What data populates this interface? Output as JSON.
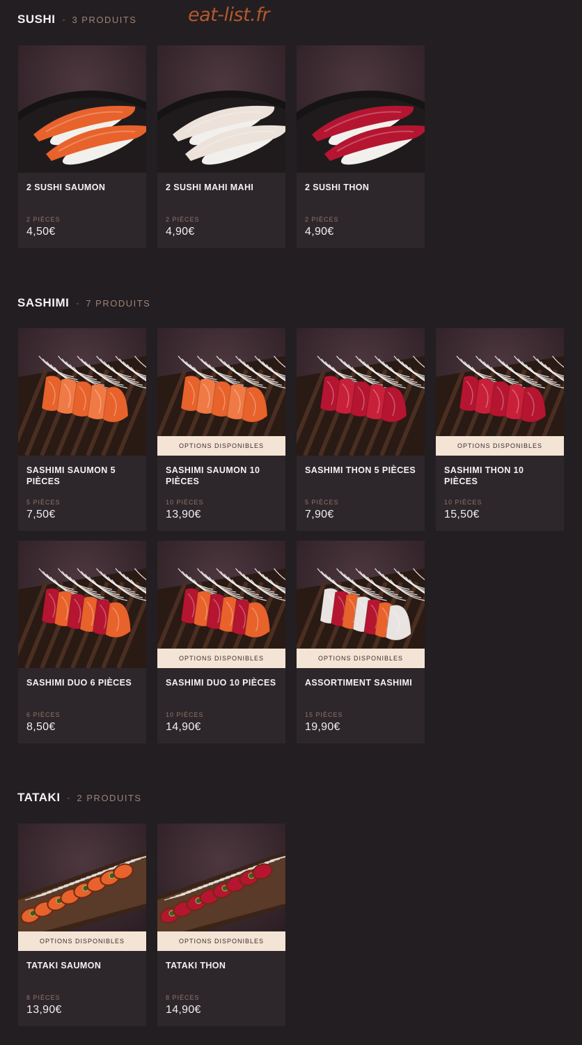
{
  "watermark": "eat-list.fr",
  "colors": {
    "background": "#221e21",
    "card": "#2d272c",
    "accent": "#a08476",
    "banner": "#f4e4d5",
    "salmon": "#e8622c",
    "tuna": "#b51530",
    "mahi": "#ece2da"
  },
  "sections": [
    {
      "title": "SUSHI",
      "separator": "-",
      "count": "3 PRODUITS",
      "products": [
        {
          "name": "2 SUSHI SAUMON",
          "pieces": "2 PIÈCES",
          "price": "4,50€",
          "options": "",
          "image": "salmon-nigiri"
        },
        {
          "name": "2 SUSHI MAHI MAHI",
          "pieces": "2 PIÈCES",
          "price": "4,90€",
          "options": "",
          "image": "mahi-nigiri"
        },
        {
          "name": "2 SUSHI THON",
          "pieces": "2 PIÈCES",
          "price": "4,90€",
          "options": "",
          "image": "tuna-nigiri"
        }
      ]
    },
    {
      "title": "SASHIMI",
      "separator": "-",
      "count": "7 PRODUITS",
      "products": [
        {
          "name": "SASHIMI SAUMON 5 PIÈCES",
          "pieces": "5 PIÈCES",
          "price": "7,50€",
          "options": "",
          "image": "salmon-sashimi"
        },
        {
          "name": "SASHIMI SAUMON 10 PIÈCES",
          "pieces": "10 PIÈCES",
          "price": "13,90€",
          "options": "OPTIONS DISPONIBLES",
          "image": "salmon-sashimi"
        },
        {
          "name": "SASHIMI THON 5 PIÈCES",
          "pieces": "5 PIÈCES",
          "price": "7,90€",
          "options": "",
          "image": "tuna-sashimi"
        },
        {
          "name": "SASHIMI THON 10 PIÈCES",
          "pieces": "10 PIÈCES",
          "price": "15,50€",
          "options": "OPTIONS DISPONIBLES",
          "image": "tuna-sashimi"
        },
        {
          "name": "SASHIMI DUO 6 PIÈCES",
          "pieces": "6 PIÈCES",
          "price": "8,50€",
          "options": "",
          "image": "duo-sashimi"
        },
        {
          "name": "SASHIMI DUO 10 PIÈCES",
          "pieces": "10 PIÈCES",
          "price": "14,90€",
          "options": "OPTIONS DISPONIBLES",
          "image": "duo-sashimi"
        },
        {
          "name": "ASSORTIMENT SASHIMI",
          "pieces": "15 PIÈCES",
          "price": "19,90€",
          "options": "OPTIONS DISPONIBLES",
          "image": "assorted-sashimi"
        }
      ]
    },
    {
      "title": "TATAKI",
      "separator": "-",
      "count": "2 PRODUITS",
      "products": [
        {
          "name": "TATAKI SAUMON",
          "pieces": "8 PIÈCES",
          "price": "13,90€",
          "options": "OPTIONS DISPONIBLES",
          "image": "salmon-tataki"
        },
        {
          "name": "TATAKI THON",
          "pieces": "8 PIÈCES",
          "price": "14,90€",
          "options": "OPTIONS DISPONIBLES",
          "image": "tuna-tataki"
        }
      ]
    }
  ]
}
